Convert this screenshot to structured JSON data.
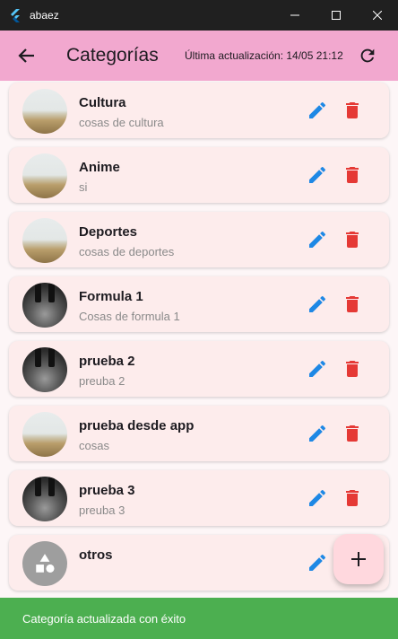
{
  "window": {
    "title": "abaez"
  },
  "appbar": {
    "title": "Categorías",
    "last_updated": "Última actualización: 14/05 21:12"
  },
  "categories": [
    {
      "name": "Cultura",
      "description": "cosas de cultura",
      "image": "landscape",
      "deletable": true
    },
    {
      "name": "Anime",
      "description": "si",
      "image": "landscape",
      "deletable": true
    },
    {
      "name": "Deportes",
      "description": "cosas de deportes",
      "image": "landscape",
      "deletable": true
    },
    {
      "name": "Formula 1",
      "description": "Cosas de formula 1",
      "image": "f1",
      "deletable": true
    },
    {
      "name": "prueba 2",
      "description": "preuba 2",
      "image": "f1",
      "deletable": true
    },
    {
      "name": "prueba desde app",
      "description": "cosas",
      "image": "landscape",
      "deletable": true
    },
    {
      "name": "prueba 3",
      "description": "preuba 3",
      "image": "f1",
      "deletable": true
    },
    {
      "name": "otros",
      "description": "",
      "image": "generic-category-icon",
      "deletable": false
    }
  ],
  "snackbar": {
    "message": "Categoría actualizada con éxito"
  },
  "colors": {
    "appbar": "#f2a8cf",
    "card": "#fdecec",
    "edit_icon": "#1e88e5",
    "delete_icon": "#e53935",
    "snackbar": "#4caf50",
    "fab": "#ffd8de"
  }
}
